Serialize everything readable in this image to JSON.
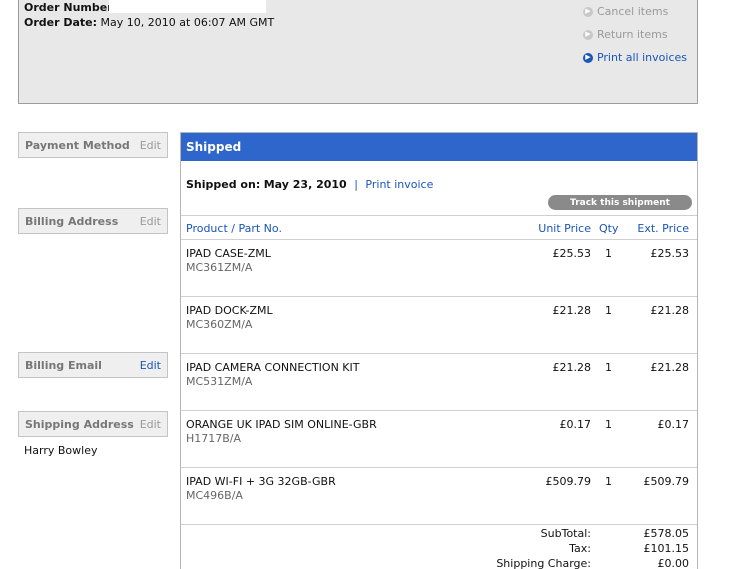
{
  "order": {
    "number_label": "Order Number:",
    "date_label": "Order Date:",
    "date_value": "May 10, 2010 at 06:07 AM GMT"
  },
  "actions": [
    {
      "label": "Cancel items",
      "icon": "cancel-arrow-icon",
      "enabled": false
    },
    {
      "label": "Return items",
      "icon": "return-arrow-icon",
      "enabled": false
    },
    {
      "label": "Print all invoices",
      "icon": "print-arrow-icon",
      "enabled": true
    }
  ],
  "sidebar": {
    "payment": {
      "title": "Payment Method",
      "edit": "Edit"
    },
    "billing": {
      "title": "Billing Address",
      "edit": "Edit"
    },
    "email": {
      "title": "Billing Email",
      "edit": "Edit"
    },
    "shipping": {
      "title": "Shipping Address",
      "edit": "Edit",
      "name": "Harry Bowley"
    }
  },
  "shipment": {
    "status": "Shipped",
    "shipped_on_label": "Shipped on:",
    "shipped_on_date": "May 23, 2010",
    "separator": "|",
    "print_invoice": "Print invoice",
    "track_button": "Track this shipment",
    "columns": {
      "product": "Product / Part No.",
      "unit": "Unit Price",
      "qty": "Qty",
      "ext": "Ext. Price"
    },
    "items": [
      {
        "name": "IPAD CASE-ZML",
        "part": "MC361ZM/A",
        "unit": "£25.53",
        "qty": "1",
        "ext": "£25.53"
      },
      {
        "name": "IPAD DOCK-ZML",
        "part": "MC360ZM/A",
        "unit": "£21.28",
        "qty": "1",
        "ext": "£21.28"
      },
      {
        "name": "IPAD CAMERA CONNECTION KIT",
        "part": "MC531ZM/A",
        "unit": "£21.28",
        "qty": "1",
        "ext": "£21.28"
      },
      {
        "name": "ORANGE UK IPAD SIM ONLINE-GBR",
        "part": "H1717B/A",
        "unit": "£0.17",
        "qty": "1",
        "ext": "£0.17"
      },
      {
        "name": "IPAD WI-FI + 3G 32GB-GBR",
        "part": "MC496B/A",
        "unit": "£509.79",
        "qty": "1",
        "ext": "£509.79"
      }
    ],
    "totals": [
      {
        "label": "SubTotal:",
        "value": "£578.05"
      },
      {
        "label": "Tax:",
        "value": "£101.15"
      },
      {
        "label": "Shipping Charge:",
        "value": "£0.00"
      }
    ]
  },
  "colors": {
    "header_blue": "#2f66cc",
    "link_blue": "#1a55b8"
  }
}
